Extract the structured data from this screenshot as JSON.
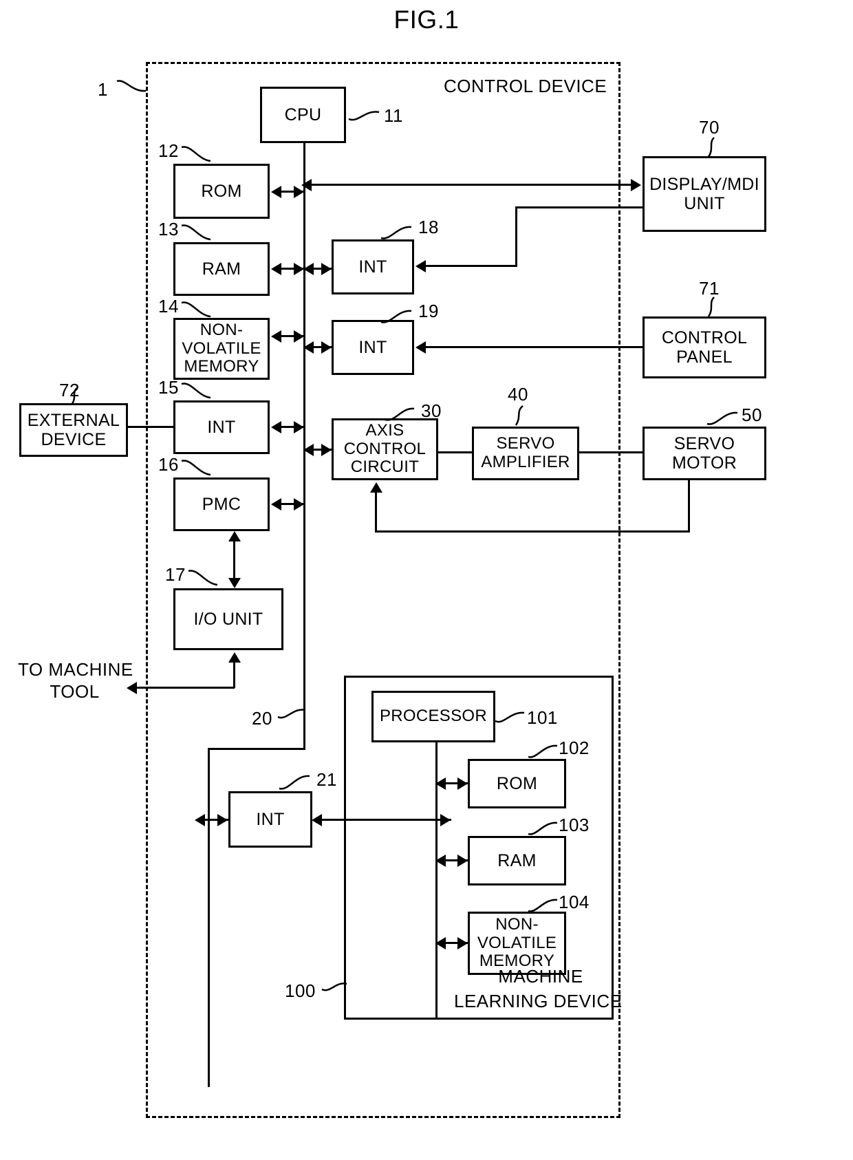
{
  "figure": {
    "title": "FIG.1"
  },
  "containers": {
    "control_device": {
      "label": "CONTROL DEVICE",
      "ref": "1"
    },
    "machine_learning_device": {
      "label_line1": "MACHINE",
      "label_line2": "LEARNING DEVICE",
      "ref": "100"
    }
  },
  "blocks": {
    "cpu": {
      "label": "CPU",
      "ref": "11"
    },
    "rom": {
      "label": "ROM",
      "ref": "12"
    },
    "ram": {
      "label": "RAM",
      "ref": "13"
    },
    "nvmem": {
      "line1": "NON-",
      "line2": "VOLATILE",
      "line3": "MEMORY",
      "ref": "14"
    },
    "int15": {
      "label": "INT",
      "ref": "15"
    },
    "pmc": {
      "label": "PMC",
      "ref": "16"
    },
    "io_unit": {
      "label": "I/O UNIT",
      "ref": "17"
    },
    "int18": {
      "label": "INT",
      "ref": "18"
    },
    "int19": {
      "label": "INT",
      "ref": "19"
    },
    "axis_control": {
      "line1": "AXIS",
      "line2": "CONTROL",
      "line3": "CIRCUIT",
      "ref": "30"
    },
    "servo_amp": {
      "line1": "SERVO",
      "line2": "AMPLIFIER",
      "ref": "40"
    },
    "servo_motor": {
      "line1": "SERVO",
      "line2": "MOTOR",
      "ref": "50"
    },
    "display_mdi": {
      "line1": "DISPLAY/MDI",
      "line2": "UNIT",
      "ref": "70"
    },
    "control_panel": {
      "line1": "CONTROL",
      "line2": "PANEL",
      "ref": "71"
    },
    "external_dev": {
      "line1": "EXTERNAL",
      "line2": "DEVICE",
      "ref": "72"
    },
    "int21": {
      "label": "INT",
      "ref": "21"
    },
    "processor": {
      "label": "PROCESSOR",
      "ref": "101"
    },
    "ml_rom": {
      "label": "ROM",
      "ref": "102"
    },
    "ml_ram": {
      "label": "RAM",
      "ref": "103"
    },
    "ml_nvmem": {
      "line1": "NON-",
      "line2": "VOLATILE",
      "line3": "MEMORY",
      "ref": "104"
    }
  },
  "annotations": {
    "bus_main": "20",
    "to_machine_tool_line1": "TO MACHINE",
    "to_machine_tool_line2": "TOOL"
  },
  "colors": {
    "stroke": "#000000",
    "background": "#ffffff"
  }
}
